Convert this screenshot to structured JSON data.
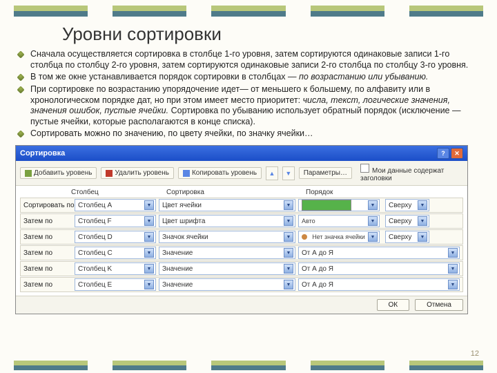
{
  "title": "Уровни сортировки",
  "bullets": [
    {
      "text": "Сначала осуществляется сортировка в столбце 1-го уровня, затем сортируются одинаковые записи 1-го столбца по столбцу 2-го уровня, затем сортируются одинаковые записи 2-го столбца по столбцу 3-го уровня."
    },
    {
      "prefix": "В том же окне устанавливается порядок сортировки в столбцах — ",
      "italic": "по возрастанию или убыванию."
    },
    {
      "prefix": "При сортировке по возрастанию упорядочение идет— от меньшего к большему, по алфавиту или в хронологическом порядке дат, но при этом имеет место приоритет: ",
      "italic": "числа, текст, логические значения, значения ошибок, пустые ячейки.",
      "suffix": " Сортировка по убыванию использует обратный порядок (исключение — пустые ячейки, которые располагаются в конце списка)."
    },
    {
      "text": "Сортировать можно по значению, по цвету ячейки, по значку ячейки…"
    }
  ],
  "dialog": {
    "title": "Сортировка",
    "toolbar": {
      "add": "Добавить уровень",
      "del": "Удалить уровень",
      "copy": "Копировать уровень",
      "params": "Параметры…",
      "headers": "Мои данные содержат заголовки"
    },
    "headers": {
      "col": "Столбец",
      "sort": "Сортировка",
      "order": "Порядок"
    },
    "rows": [
      {
        "label": "Сортировать по",
        "col": "Столбец A",
        "sort": "Цвет ячейки",
        "order_type": "swatch-green",
        "side": "Сверху"
      },
      {
        "label": "Затем по",
        "col": "Столбец F",
        "sort": "Цвет шрифта",
        "order_type": "auto",
        "order": "Авто",
        "side": "Сверху"
      },
      {
        "label": "Затем по",
        "col": "Столбец D",
        "sort": "Значок ячейки",
        "order_type": "noicon",
        "order": "Нет значка ячейки",
        "side": "Сверху"
      },
      {
        "label": "Затем по",
        "col": "Столбец C",
        "sort": "Значение",
        "order_type": "plain",
        "order": "От А до Я"
      },
      {
        "label": "Затем по",
        "col": "Столбец K",
        "sort": "Значение",
        "order_type": "plain",
        "order": "От А до Я"
      },
      {
        "label": "Затем по",
        "col": "Столбец E",
        "sort": "Значение",
        "order_type": "plain",
        "order": "От А до Я"
      }
    ],
    "ok": "ОК",
    "cancel": "Отмена"
  },
  "page": "12"
}
